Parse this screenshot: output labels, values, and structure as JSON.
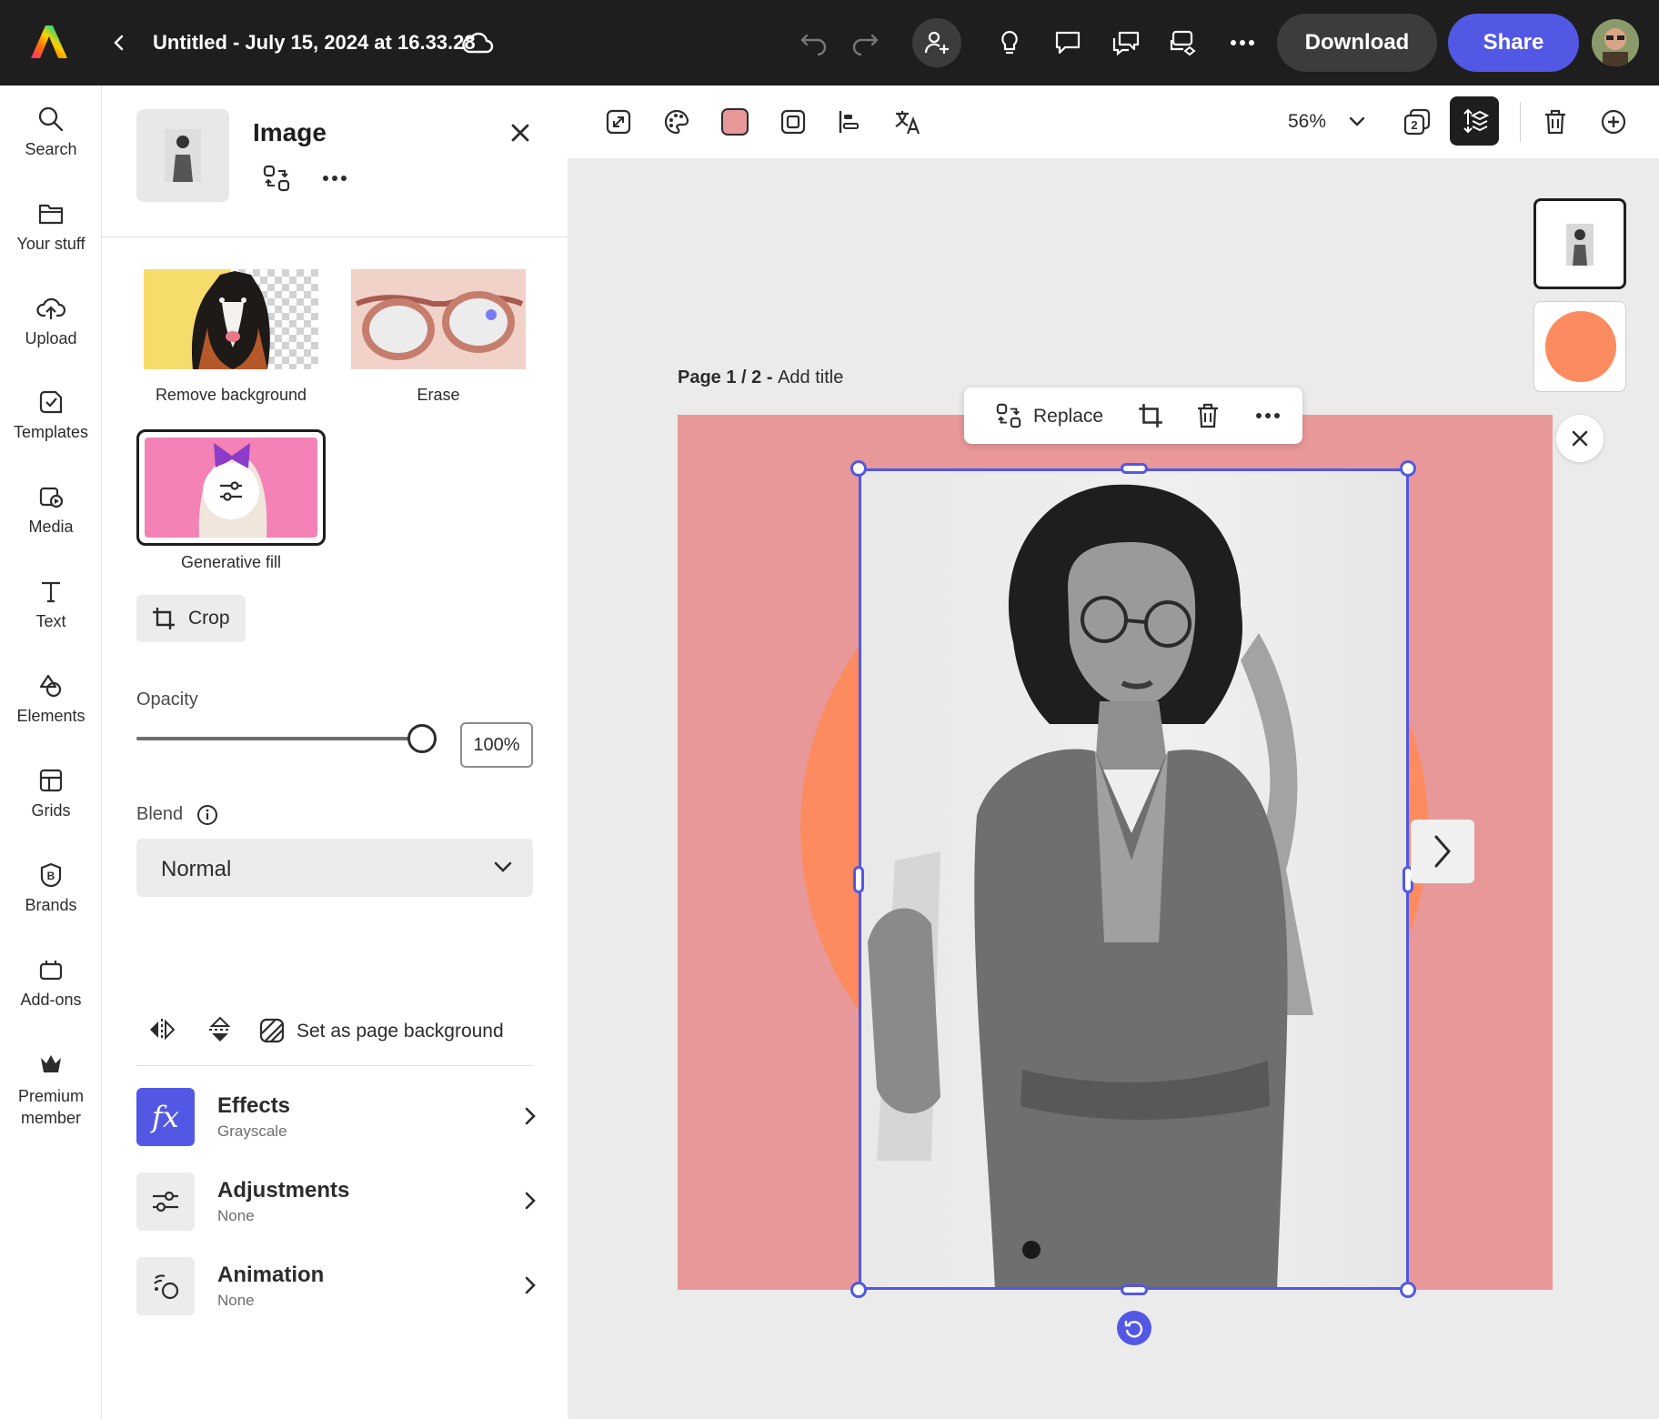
{
  "app": {
    "title": "Untitled - July 15, 2024 at 16.33.28",
    "download_label": "Download",
    "share_label": "Share",
    "accent": "#5258e4"
  },
  "rail": {
    "items": [
      {
        "label": "Search",
        "icon": "search-icon"
      },
      {
        "label": "Your stuff",
        "icon": "folder-icon"
      },
      {
        "label": "Upload",
        "icon": "upload-cloud-icon"
      },
      {
        "label": "Templates",
        "icon": "templates-icon"
      },
      {
        "label": "Media",
        "icon": "media-icon"
      },
      {
        "label": "Text",
        "icon": "text-icon"
      },
      {
        "label": "Elements",
        "icon": "elements-icon"
      },
      {
        "label": "Grids",
        "icon": "grids-icon"
      },
      {
        "label": "Brands",
        "icon": "brands-icon"
      },
      {
        "label": "Add-ons",
        "icon": "addons-icon"
      },
      {
        "label": "Premium member",
        "icon": "premium-crown-icon"
      }
    ]
  },
  "panel": {
    "title": "Image",
    "quick_actions": [
      {
        "label": "Remove background"
      },
      {
        "label": "Erase"
      },
      {
        "label": "Generative fill"
      }
    ],
    "crop_label": "Crop",
    "opacity": {
      "label": "Opacity",
      "value": "100%",
      "fraction": 1.0
    },
    "blend": {
      "label": "Blend",
      "selected": "Normal"
    },
    "set_background_label": "Set as page background",
    "properties": [
      {
        "title": "Effects",
        "subtitle": "Grayscale",
        "icon": "fx-icon"
      },
      {
        "title": "Adjustments",
        "subtitle": "None",
        "icon": "sliders-icon"
      },
      {
        "title": "Animation",
        "subtitle": "None",
        "icon": "animation-icon"
      }
    ]
  },
  "canvas": {
    "zoom": "56%",
    "page_label": "Page 1 / 2 - ",
    "add_title": "Add title",
    "replace_label": "Replace",
    "page_color": "#e89898",
    "shape_color": "#fc8b60",
    "pages_badge": "2"
  }
}
